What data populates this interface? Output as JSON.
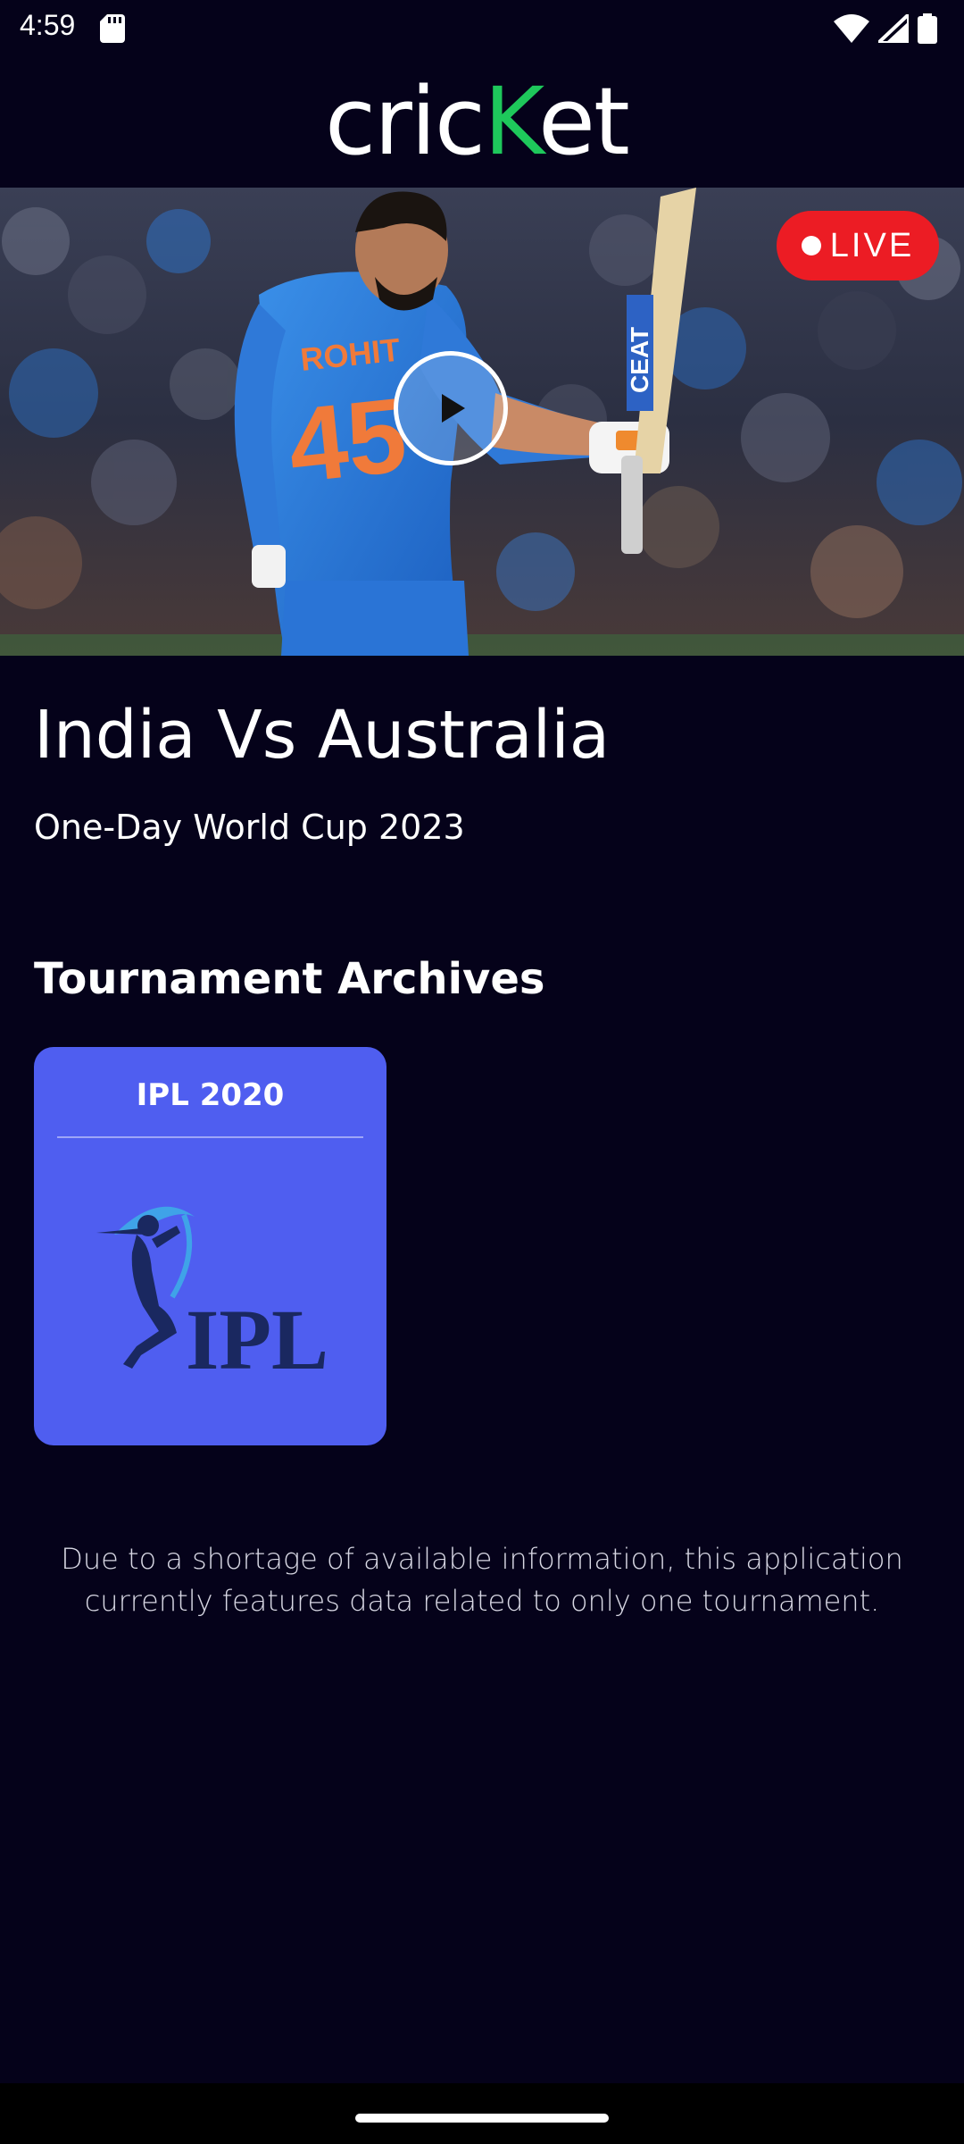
{
  "status_bar": {
    "time": "4:59",
    "icons": [
      "sd-card-icon",
      "wifi-icon",
      "signal-icon",
      "battery-icon"
    ]
  },
  "header": {
    "logo_text_start": "cric",
    "logo_text_accent": "K",
    "logo_text_end": "et",
    "accent_color": "#1ec85b"
  },
  "hero": {
    "live_label": "LIVE",
    "live_color": "#ec1c24",
    "jersey_name": "ROHIT",
    "jersey_number": "45",
    "bat_brand": "CEAT"
  },
  "match": {
    "title": "India Vs Australia",
    "subtitle": "One-Day World Cup 2023"
  },
  "archives": {
    "section_title": "Tournament Archives",
    "cards": [
      {
        "title": "IPL 2020",
        "logo_text": "IPL",
        "card_color": "#4f5ef0"
      }
    ]
  },
  "notice": "Due to a shortage of available information, this application currently features data related to only one tournament."
}
